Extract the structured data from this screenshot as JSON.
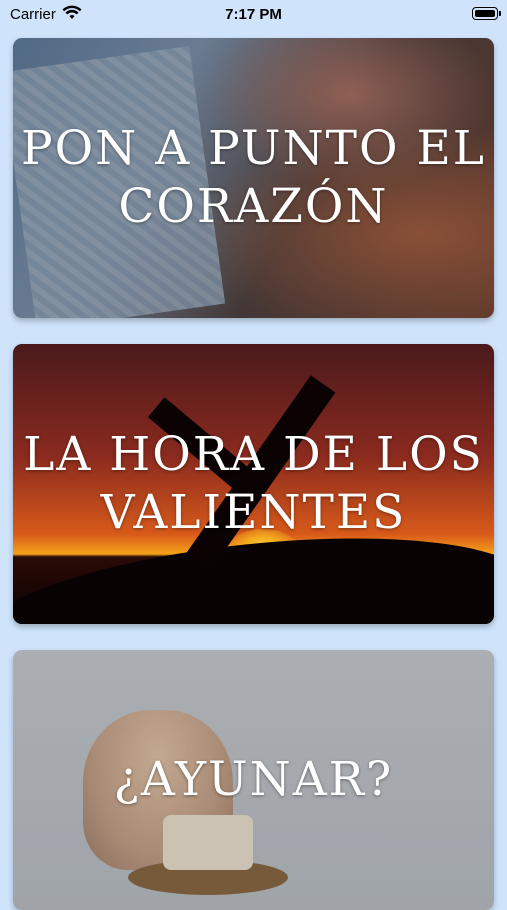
{
  "status_bar": {
    "carrier": "Carrier",
    "time": "7:17 PM"
  },
  "cards": [
    {
      "title": "PON A PUNTO EL CORAZÓN"
    },
    {
      "title": "LA HORA DE LOS VALIENTES"
    },
    {
      "title": "¿AYUNAR?"
    }
  ],
  "colors": {
    "background": "#cfe3fb",
    "title_text": "#ffffff"
  }
}
